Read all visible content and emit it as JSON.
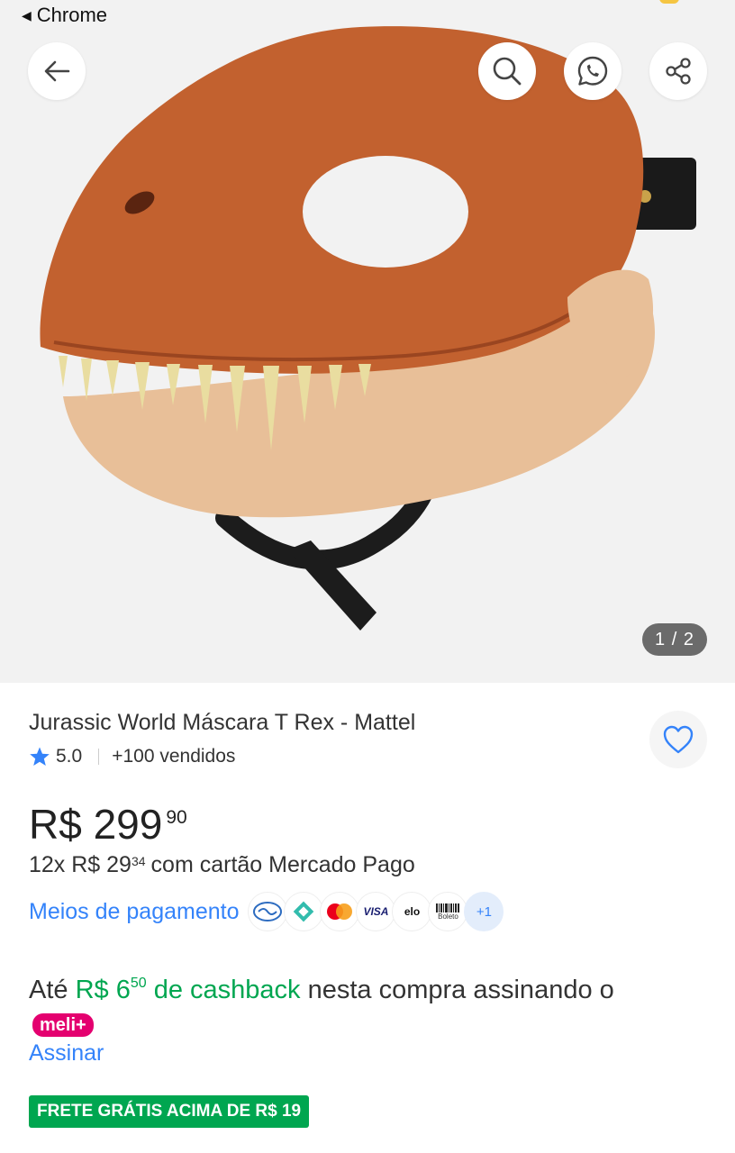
{
  "status_bar": {
    "back_app": "Chrome"
  },
  "header": {
    "back_icon": "arrow-left-icon",
    "search_icon": "search-icon",
    "whatsapp_icon": "whatsapp-icon",
    "share_icon": "share-icon"
  },
  "gallery": {
    "counter": "1 / 2"
  },
  "product": {
    "title": "Jurassic World Máscara T Rex - Mattel",
    "rating": "5.0",
    "sold": "+100 vendidos",
    "price_main": "R$ 299",
    "price_cents": "90",
    "installments_prefix": "12x R$ 29",
    "installments_cents": "34",
    "installments_suffix": "com cartão Mercado Pago"
  },
  "payment": {
    "link": "Meios de pagamento",
    "methods": [
      "VISA",
      "elo",
      "Boleto"
    ],
    "more": "+1"
  },
  "cashback": {
    "prefix": "Até",
    "amount": "R$ 6",
    "amount_cents": "50",
    "amount_suffix": "de cashback",
    "middle": "nesta compra assinando o",
    "badge": "meli+",
    "subscribe": "Assinar"
  },
  "shipping": {
    "badge": "FRETE GRÁTIS ACIMA DE R$ 19"
  },
  "colors": {
    "accent": "#3483fa",
    "green": "#00a650",
    "meli_pink": "#e4006f"
  }
}
